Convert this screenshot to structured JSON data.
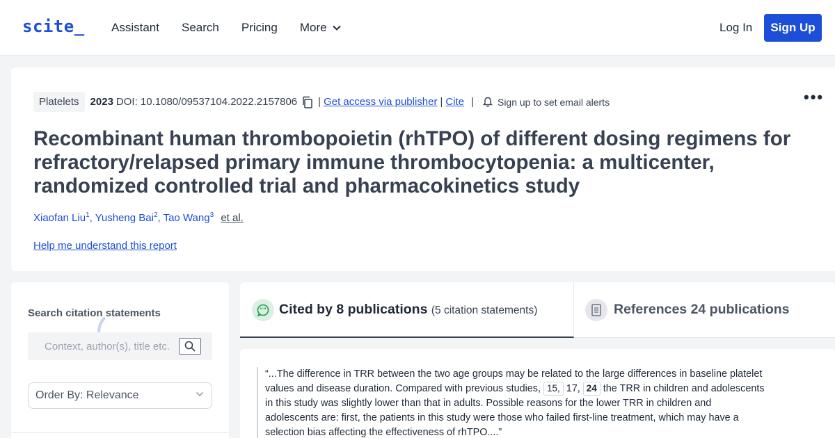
{
  "header": {
    "logo": "scite_",
    "nav": [
      "Assistant",
      "Search",
      "Pricing",
      "More"
    ],
    "login": "Log In",
    "signup": "Sign Up"
  },
  "paper": {
    "tag": "Platelets",
    "year": "2023",
    "doi": "DOI: 10.1080/09537104.2022.2157806",
    "access": "Get access via publisher",
    "cite": "Cite",
    "alerts": "Sign up to set email alerts",
    "title": "Recombinant human thrombopoietin (rhTPO) of different dosing regimens for refractory/relapsed primary immune thrombocytopenia: a multicenter, randomized controlled trial and pharmacokinetics study",
    "authors": [
      {
        "name": "Xiaofan Liu",
        "sup": "1"
      },
      {
        "name": "Yusheng Bai",
        "sup": "2"
      },
      {
        "name": "Tao Wang",
        "sup": "3"
      }
    ],
    "etal": "et al.",
    "help": "Help me understand this report"
  },
  "sidebar": {
    "title": "Search citation statements",
    "search_placeholder": "Context, author(s), title etc.",
    "order": "Order By: Relevance"
  },
  "tabs": {
    "cited_label": "Cited by 8 publications",
    "cited_sub": "(5 citation statements)",
    "refs_label": "References 24 publications"
  },
  "citation": {
    "before": "“...The difference in TRR between the two age groups may be related to the large differences in baseline platelet values and disease duration. Compared with previous studies, ",
    "refs": [
      "15,",
      "17,",
      "24"
    ],
    "after": " the TRR in children and adolescents in this study was slightly lower than that in adults. Possible reasons for the lower TRR in children and adolescents are: first, the patients in this study were those who failed first-line treatment, which may have a selection bias affecting the effectiveness of rhTPO....”"
  },
  "colors": {
    "brand": "#1d4ed8",
    "background": "#f3f4f6",
    "cited_icon": "#16a34a"
  },
  "icons": [
    "chevron-down-icon",
    "copy-icon",
    "bell-icon",
    "more-icon",
    "search-icon",
    "chat-quote-icon",
    "document-icon"
  ]
}
